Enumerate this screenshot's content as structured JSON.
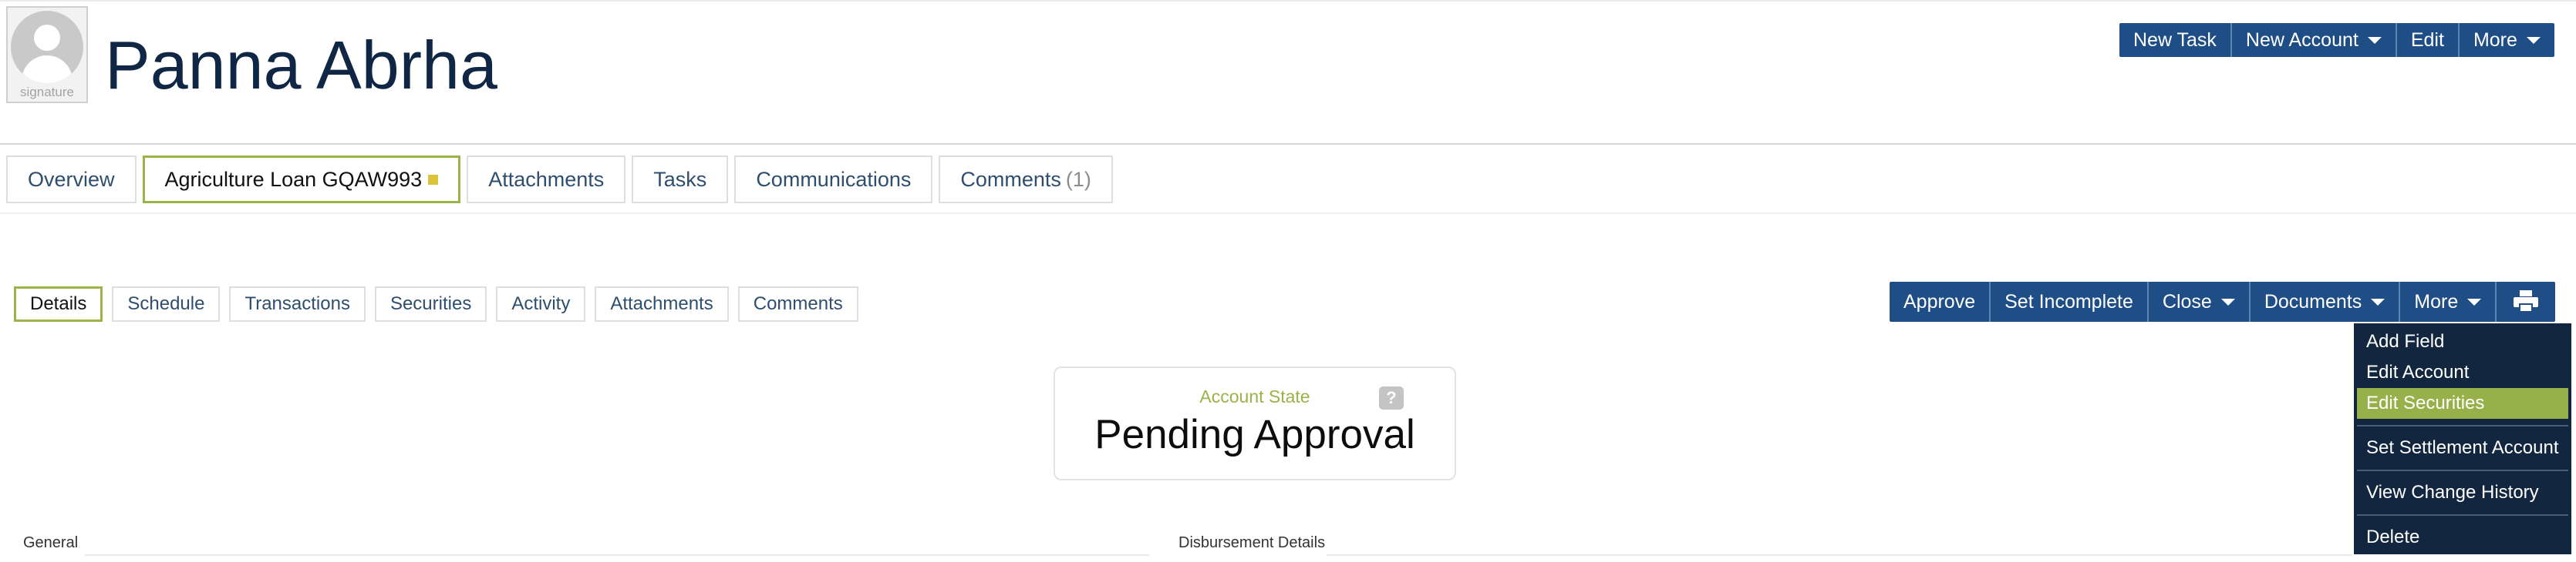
{
  "person": {
    "name": "Panna Abrha",
    "avatar_caption": "signature"
  },
  "header_actions": {
    "new_task": "New Task",
    "new_account": "New Account",
    "edit": "Edit",
    "more": "More"
  },
  "top_tabs": {
    "overview": "Overview",
    "loan": "Agriculture Loan GQAW993",
    "attachments": "Attachments",
    "tasks": "Tasks",
    "communications": "Communications",
    "comments": "Comments",
    "comments_count": "(1)"
  },
  "sub_tabs": {
    "details": "Details",
    "schedule": "Schedule",
    "transactions": "Transactions",
    "securities": "Securities",
    "activity": "Activity",
    "attachments": "Attachments",
    "comments": "Comments"
  },
  "account_actions": {
    "approve": "Approve",
    "set_incomplete": "Set Incomplete",
    "close": "Close",
    "documents": "Documents",
    "more": "More"
  },
  "more_menu": {
    "add_field": "Add Field",
    "edit_account": "Edit Account",
    "edit_securities": "Edit Securities",
    "set_settlement_account": "Set Settlement Account",
    "view_change_history": "View Change History",
    "delete": "Delete"
  },
  "account_state": {
    "label": "Account State",
    "value": "Pending Approval",
    "help": "?"
  },
  "sections": {
    "general": "General",
    "disbursement": "Disbursement Details"
  },
  "colors": {
    "primary": "#1f4e86",
    "accent": "#9bb348",
    "menu_bg": "#12263f",
    "title": "#0f2744"
  },
  "icons": [
    "avatar-placeholder-icon",
    "caret-down-icon",
    "print-icon",
    "help-icon",
    "tab-status-icon"
  ]
}
